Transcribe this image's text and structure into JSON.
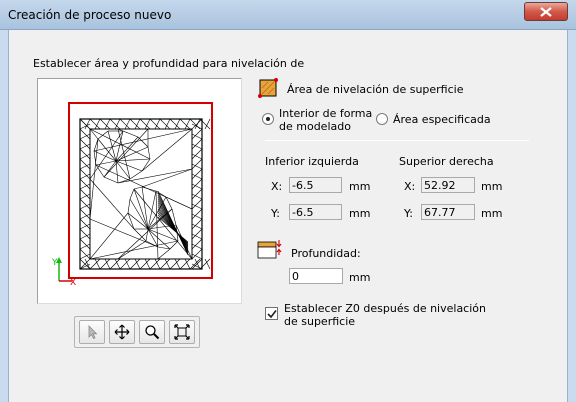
{
  "window": {
    "title": "Creación de proceso nuevo"
  },
  "header": {
    "instruction": "Establecer área y profundidad para nivelación de"
  },
  "area": {
    "label": "Área de nivelación de superficie",
    "option_interior_line1": "Interior de forma",
    "option_interior_line2": "de modelado",
    "option_specified": "Área especificada",
    "selected": "interior"
  },
  "lower_left": {
    "heading": "Inferior izquierda",
    "x_label": "X:",
    "x_value": "-6.5",
    "y_label": "Y:",
    "y_value": "-6.5",
    "unit": "mm"
  },
  "upper_right": {
    "heading": "Superior derecha",
    "x_label": "X:",
    "x_value": "52.92",
    "y_label": "Y:",
    "y_value": "67.77",
    "unit": "mm"
  },
  "depth": {
    "label": "Profundidad:",
    "value": "0",
    "unit": "mm"
  },
  "z0": {
    "line1": "Establecer Z0 después de nivelación",
    "line2": "de superficie",
    "checked": true
  },
  "preview": {
    "axis_y": "Y",
    "axis_x": "X"
  },
  "toolbar": {
    "icons": [
      "pointer-icon",
      "pan-icon",
      "zoom-icon",
      "fit-view-icon"
    ]
  },
  "colors": {
    "selection_frame": "#d40000",
    "axis_y": "#14b814",
    "axis_x": "#d40000"
  }
}
